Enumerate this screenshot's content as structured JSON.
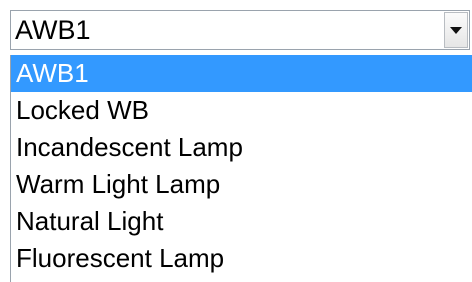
{
  "select": {
    "value": "AWB1",
    "arrow_icon": "triangle-down-icon"
  },
  "dropdown": {
    "options": [
      {
        "label": "AWB1",
        "selected": true
      },
      {
        "label": "Locked WB",
        "selected": false
      },
      {
        "label": "Incandescent Lamp",
        "selected": false
      },
      {
        "label": "Warm Light Lamp",
        "selected": false
      },
      {
        "label": "Natural Light",
        "selected": false
      },
      {
        "label": "Fluorescent Lamp",
        "selected": false
      }
    ]
  },
  "colors": {
    "highlight": "#3399ff",
    "highlight_text": "#ffffff",
    "border": "#9aa3ad"
  }
}
